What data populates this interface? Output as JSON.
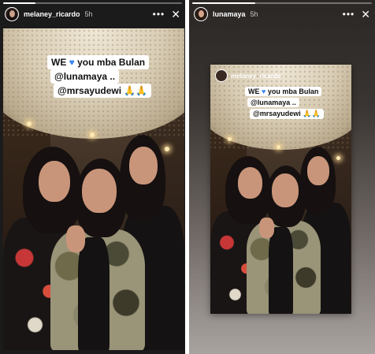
{
  "stories": [
    {
      "progress": 0.18,
      "username": "melaney_ricardo",
      "time": "5h",
      "more_icon": "more-dots-icon",
      "close_icon": "close-icon",
      "caption": {
        "line1_before": "WE ",
        "line1_after": " you mba Bulan",
        "line2": "@lunamaya ..",
        "line3": "@mrsayudewi 🙏🙏"
      }
    },
    {
      "progress": 0.35,
      "username": "lunamaya",
      "time": "5h",
      "more_icon": "more-dots-icon",
      "close_icon": "close-icon",
      "reshared": {
        "username": "melaney_ricardo",
        "caption": {
          "line1_before": "WE ",
          "line1_after": " you mba Bulan",
          "line2": "@lunamaya ..",
          "line3": "@mrsayudewi 🙏🙏"
        }
      }
    }
  ],
  "colors": {
    "heart": "#3b82f6",
    "panel_bg": "#1b1b1b"
  }
}
